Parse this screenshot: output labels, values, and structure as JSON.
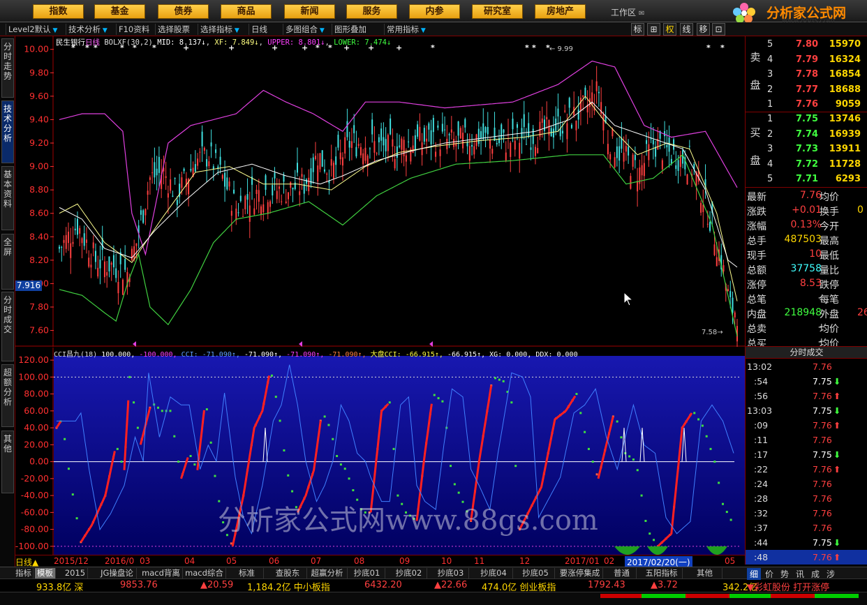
{
  "top_menu": [
    "指数",
    "基金",
    "债券",
    "商品",
    "新闻",
    "服务",
    "内参",
    "研究室",
    "房地产"
  ],
  "work_area": "工作区",
  "logo": {
    "title": "分析家公式网",
    "url": "www.88gs.com"
  },
  "toolbar": {
    "items": [
      "Level2默认",
      "技术分析",
      "F10资料",
      "选择股票",
      "选择指标",
      "日线",
      "多图组合",
      "图形叠加",
      "常用指标"
    ],
    "right_buttons": [
      "标",
      "⊞",
      "权",
      "线",
      "移",
      "⊡"
    ]
  },
  "left_tabs": [
    "分时走势",
    "技术分析",
    "基本资料",
    "全屏",
    "分时成交",
    "超额分析",
    "其他"
  ],
  "price_chart": {
    "legend": {
      "name": "民生银行",
      "period": "日线",
      "indicator": "BOLXF(30,2)",
      "mid": "MID: 8.137↓",
      "xf": "XF: 7.849↓",
      "upper": "UPPER: 8.801↓",
      "lower": "LOWER: 7.474↓"
    },
    "y_ticks": [
      "10.00",
      "9.80",
      "9.60",
      "9.40",
      "9.20",
      "9.00",
      "8.80",
      "8.60",
      "8.40",
      "8.20",
      "8.00",
      "7.80",
      "7.60"
    ],
    "y_range": [
      7.52,
      10.04
    ],
    "cursor_price": "7.916",
    "high_label": "9.99",
    "low_label": "7.58"
  },
  "cci_chart": {
    "legend": {
      "name": "CCI昌九(18)",
      "v1": "100.000,",
      "v2": "-100.000,",
      "v3": "CCI: -71.090↑,",
      "v4": "-71.090↑,",
      "v5": "-71.090↑,",
      "v6": "-71.090↑,",
      "v7": "大盘CCI: -66.915↑,",
      "v8": "-66.915↑,",
      "v9": "XG: 0.000,",
      "v10": "DDX: 0.000"
    },
    "y_ticks": [
      "120.00",
      "100.00",
      "80.00",
      "60.00",
      "40.00",
      "20.00",
      "0.00",
      "-20.00",
      "-40.00",
      "-60.00",
      "-80.00",
      "-100.00"
    ],
    "y_range": [
      -110,
      125
    ]
  },
  "date_bar": {
    "period": "日线▲",
    "labels": [
      "2015/12",
      "2016/0",
      "03",
      "04",
      "05",
      "06",
      "07",
      "08",
      "09",
      "10",
      "11",
      "12",
      "2017/01",
      "02"
    ],
    "current": "2017/02/20(一)",
    "end": "05"
  },
  "bottom_tabs": [
    "指标",
    "模板",
    "2015",
    "JG操盘论",
    "macd背离",
    "macd综合",
    "标准",
    "查股东",
    "超赢分析",
    "抄底01",
    "抄底02",
    "抄底03",
    "抄底04",
    "抄底05",
    "要涨停集成",
    "普通",
    "五阳指标",
    "其他"
  ],
  "order_book": {
    "sell_label": "卖盘",
    "buy_label": "买盘",
    "sells": [
      {
        "n": "5",
        "p": "7.80",
        "v": "15970"
      },
      {
        "n": "4",
        "p": "7.79",
        "v": "16324"
      },
      {
        "n": "3",
        "p": "7.78",
        "v": "16854"
      },
      {
        "n": "2",
        "p": "7.77",
        "v": "18688"
      },
      {
        "n": "1",
        "p": "7.76",
        "v": "9059"
      }
    ],
    "buys": [
      {
        "n": "1",
        "p": "7.75",
        "v": "13746"
      },
      {
        "n": "2",
        "p": "7.74",
        "v": "16939"
      },
      {
        "n": "3",
        "p": "7.73",
        "v": "13911"
      },
      {
        "n": "4",
        "p": "7.72",
        "v": "11728"
      },
      {
        "n": "5",
        "p": "7.71",
        "v": "6293"
      }
    ]
  },
  "stats": [
    {
      "l": "最新",
      "v": "7.76",
      "vc": "#ff4040",
      "r": "均价",
      "rv": "",
      "rc": "#ffd700"
    },
    {
      "l": "涨跌",
      "v": "+0.01",
      "vc": "#ff4040",
      "r": "换手",
      "rv": "0",
      "rc": "#ffd700"
    },
    {
      "l": "涨幅",
      "v": "0.13%",
      "vc": "#ff4040",
      "r": "今开",
      "rv": "",
      "rc": "#ffd700"
    },
    {
      "l": "总手",
      "v": "487503",
      "vc": "#ffd700",
      "r": "最高",
      "rv": "",
      "rc": "#ffd700"
    },
    {
      "l": "现手",
      "v": "10",
      "vc": "#ff4040",
      "r": "最低",
      "rv": "",
      "rc": "#ffd700"
    },
    {
      "l": "总额",
      "v": "37758",
      "vc": "#40ffff",
      "r": "量比",
      "rv": "",
      "rc": "#ffd700"
    },
    {
      "l": "涨停",
      "v": "8.53",
      "vc": "#ff4040",
      "r": "跌停",
      "rv": "",
      "rc": "#ffd700"
    },
    {
      "l": "总笔",
      "v": "-",
      "vc": "#ddd",
      "r": "每笔",
      "rv": "",
      "rc": "#ffd700"
    },
    {
      "l": "内盘",
      "v": "218948",
      "vc": "#40ff40",
      "r": "外盘",
      "rv": "26",
      "rc": "#ff4040"
    },
    {
      "l": "总卖",
      "v": "-",
      "vc": "#ddd",
      "r": "均价",
      "rv": "",
      "rc": "#ffd700"
    },
    {
      "l": "总买",
      "v": "-",
      "vc": "#ddd",
      "r": "均价",
      "rv": "",
      "rc": "#ffd700"
    }
  ],
  "ticks_header": "分时成交",
  "ticks": [
    {
      "t": "13:02",
      "p": "7.76",
      "c": "#ff4040",
      "a": "",
      "ac": "#ff4040"
    },
    {
      "t": ":54",
      "p": "7.75",
      "c": "#fff",
      "a": "⬇",
      "ac": "#40ff40"
    },
    {
      "t": ":56",
      "p": "7.76",
      "c": "#ff4040",
      "a": "⬆",
      "ac": "#ff4040"
    },
    {
      "t": "13:03",
      "p": "7.75",
      "c": "#fff",
      "a": "⬇",
      "ac": "#40ff40"
    },
    {
      "t": ":09",
      "p": "7.76",
      "c": "#ff4040",
      "a": "⬆",
      "ac": "#ff4040"
    },
    {
      "t": ":11",
      "p": "7.76",
      "c": "#ff4040",
      "a": "",
      "ac": "#ff4040"
    },
    {
      "t": ":17",
      "p": "7.75",
      "c": "#fff",
      "a": "⬇",
      "ac": "#40ff40"
    },
    {
      "t": ":22",
      "p": "7.76",
      "c": "#ff4040",
      "a": "⬆",
      "ac": "#ff4040"
    },
    {
      "t": ":24",
      "p": "7.76",
      "c": "#ff4040",
      "a": "",
      "ac": "#ff4040"
    },
    {
      "t": ":28",
      "p": "7.76",
      "c": "#ff4040",
      "a": "",
      "ac": "#ff4040"
    },
    {
      "t": ":32",
      "p": "7.76",
      "c": "#ff4040",
      "a": "",
      "ac": "#ff4040"
    },
    {
      "t": ":37",
      "p": "7.76",
      "c": "#ff4040",
      "a": "",
      "ac": "#ff4040"
    },
    {
      "t": ":44",
      "p": "7.75",
      "c": "#fff",
      "a": "⬇",
      "ac": "#40ff40"
    },
    {
      "t": ":48",
      "p": "7.76",
      "c": "#ff4040",
      "a": "⬆",
      "ac": "#ff4040"
    }
  ],
  "right_tabs": [
    "细",
    "价",
    "势",
    "讯",
    "成",
    "涉"
  ],
  "index_bar": [
    {
      "t": "933.8亿 深",
      "c": "#ffd700"
    },
    {
      "t": "9853.76",
      "c": "#ff4040"
    },
    {
      "t": "▲20.59",
      "c": "#ff4040"
    },
    {
      "t": "1,184.2亿 中小板指",
      "c": "#ffd700"
    },
    {
      "t": "6432.20",
      "c": "#ff4040"
    },
    {
      "t": "▲22.66",
      "c": "#ff4040"
    },
    {
      "t": "474.0亿 创业板指",
      "c": "#ffd700"
    },
    {
      "t": "1792.43",
      "c": "#ff4040"
    },
    {
      "t": "▲3.72",
      "c": "#ff4040"
    },
    {
      "t": "342.2亿",
      "c": "#ffd700"
    },
    {
      "t": "▼彩虹股份 打开涨停",
      "c": "#ff4040"
    }
  ],
  "watermark": "分析家公式网www.88gs.com"
}
